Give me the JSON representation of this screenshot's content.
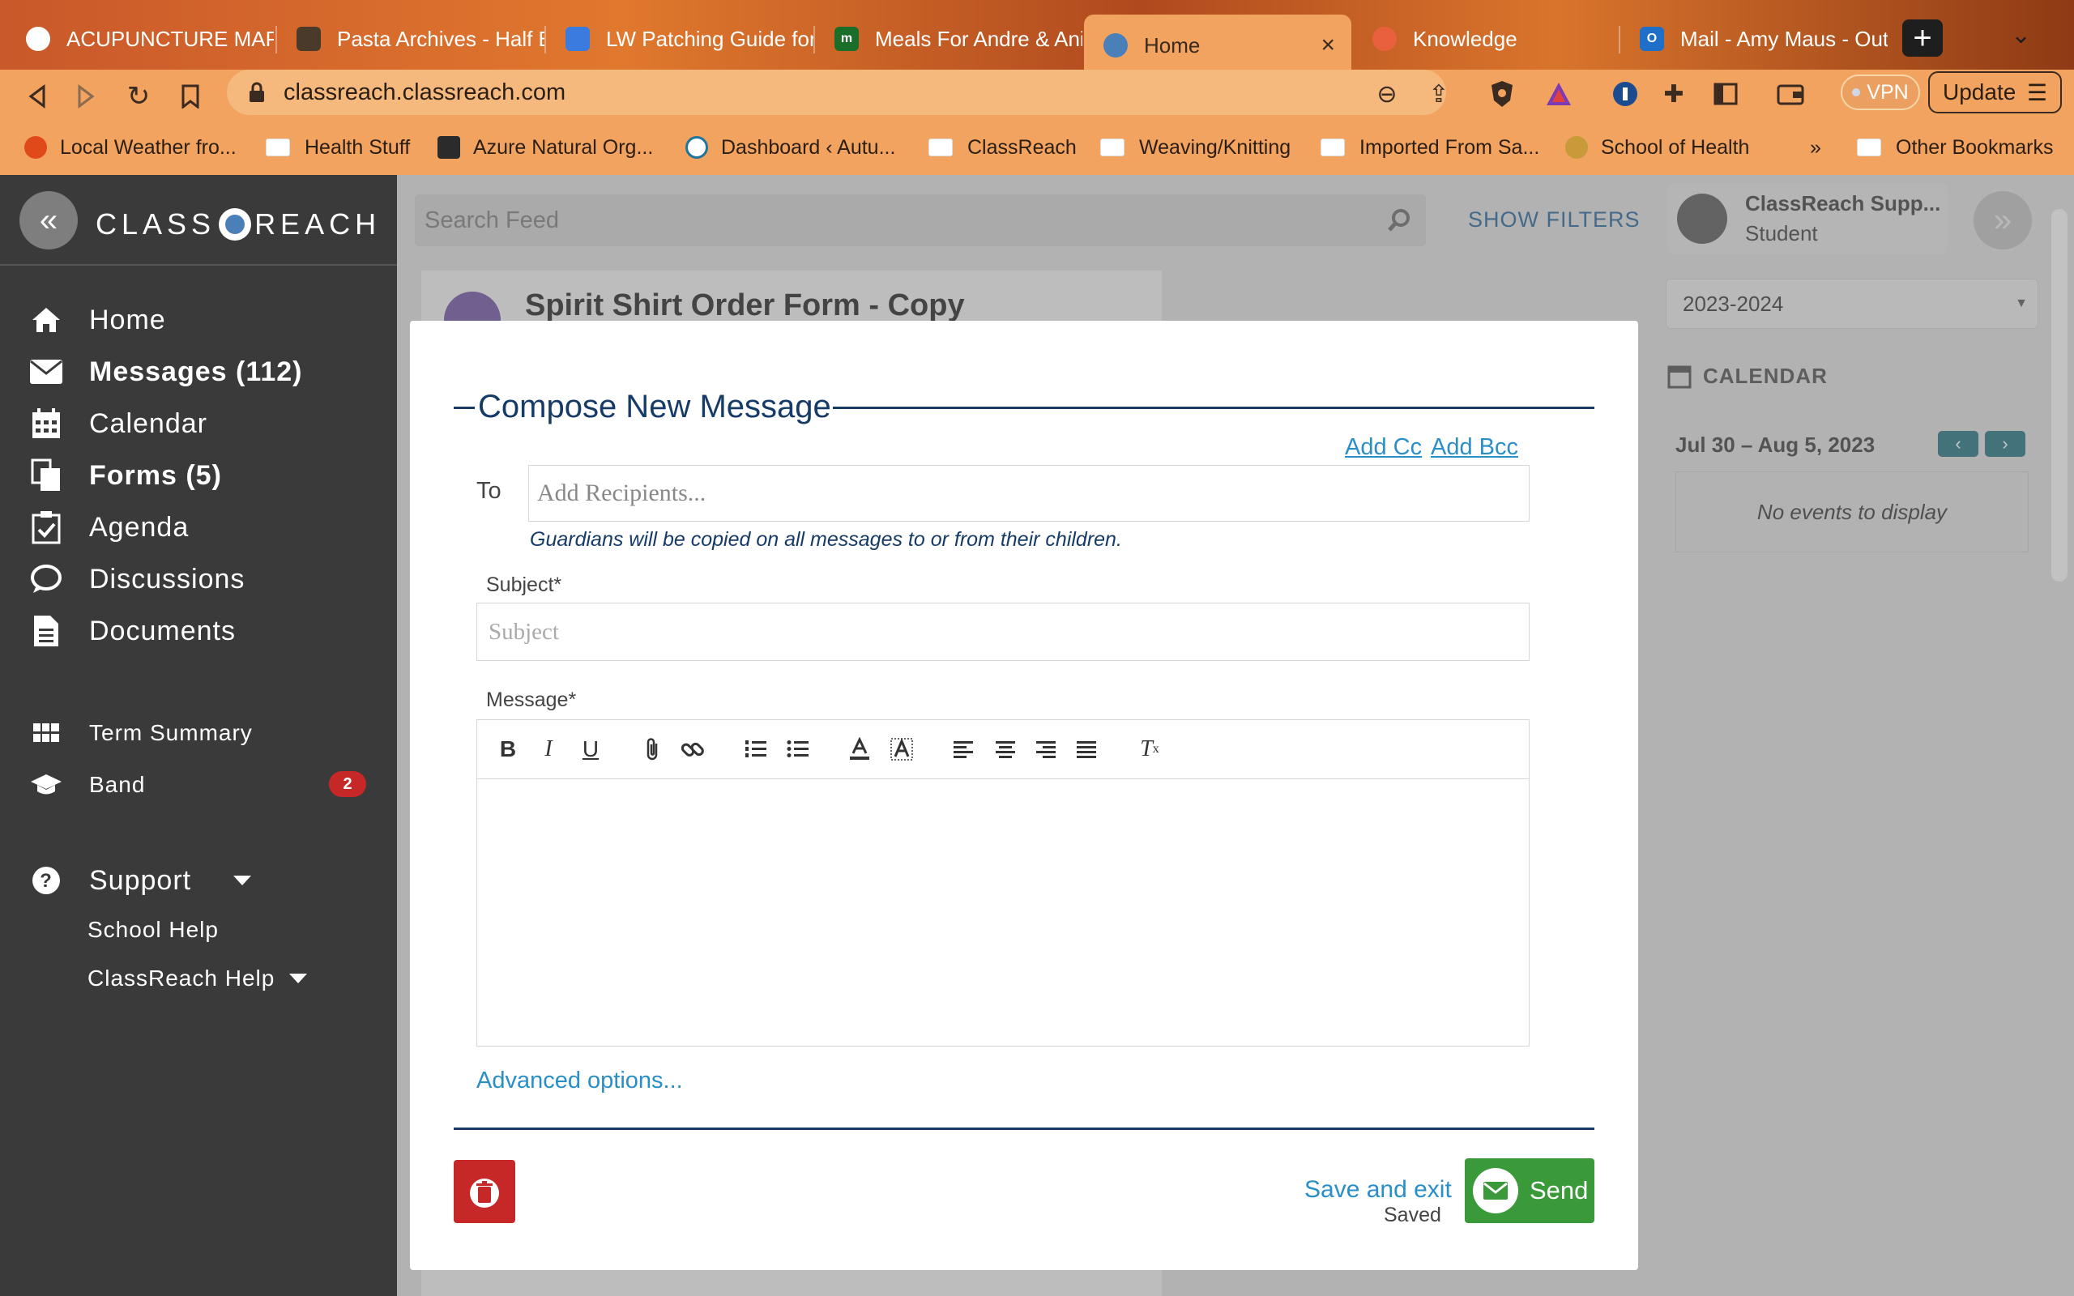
{
  "browser": {
    "tabs": [
      {
        "label": "ACUPUNCTURE MAP A"
      },
      {
        "label": "Pasta Archives - Half B"
      },
      {
        "label": "LW Patching Guide for"
      },
      {
        "label": "Meals For Andre & Ania"
      },
      {
        "label": "Home"
      },
      {
        "label": "Knowledge"
      },
      {
        "label": "Mail - Amy Maus - Out"
      }
    ],
    "url": "classreach.classreach.com",
    "vpn_label": "VPN",
    "update_label": "Update",
    "bookmarks": [
      {
        "label": "Local Weather fro..."
      },
      {
        "label": "Health Stuff"
      },
      {
        "label": "Azure Natural Org..."
      },
      {
        "label": "Dashboard ‹ Autu..."
      },
      {
        "label": "ClassReach"
      },
      {
        "label": "Weaving/Knitting"
      },
      {
        "label": "Imported From Sa..."
      },
      {
        "label": "School of Health"
      },
      {
        "label": "»"
      },
      {
        "label": "Other Bookmarks"
      }
    ]
  },
  "sidebar": {
    "logo_left": "CLASS",
    "logo_right": "REACH",
    "items": [
      {
        "label": "Home"
      },
      {
        "label": "Messages (112)"
      },
      {
        "label": "Calendar"
      },
      {
        "label": "Forms (5)"
      },
      {
        "label": "Agenda"
      },
      {
        "label": "Discussions"
      },
      {
        "label": "Documents"
      }
    ],
    "term_summary": "Term Summary",
    "band": "Band",
    "band_badge": "2",
    "support": "Support",
    "school_help": "School Help",
    "classreach_help": "ClassReach Help"
  },
  "feed": {
    "search_placeholder": "Search Feed",
    "show_filters": "SHOW FILTERS",
    "card_title": "Spirit Shirt Order Form - Copy"
  },
  "right_panel": {
    "user_name": "ClassReach Supp...",
    "user_role": "Student",
    "year": "2023-2024",
    "calendar_heading": "CALENDAR",
    "date_range": "Jul 30 – Aug 5, 2023",
    "no_events": "No events to display"
  },
  "compose": {
    "title": "Compose New Message",
    "add_cc": "Add Cc",
    "add_bcc": "Add Bcc",
    "to_label": "To",
    "to_placeholder": "Add Recipients...",
    "guardian_note": "Guardians will be copied on all messages to or from their children.",
    "subject_label": "Subject*",
    "subject_placeholder": "Subject",
    "message_label": "Message*",
    "advanced_options": "Advanced options...",
    "save_exit": "Save and exit",
    "saved": "Saved",
    "send": "Send"
  },
  "colors": {
    "sidebar_bg": "#3a3a3a",
    "title_navy": "#163b66",
    "link_blue": "#2a8fc6",
    "send_green": "#3a9a3a",
    "delete_red": "#c62828"
  }
}
